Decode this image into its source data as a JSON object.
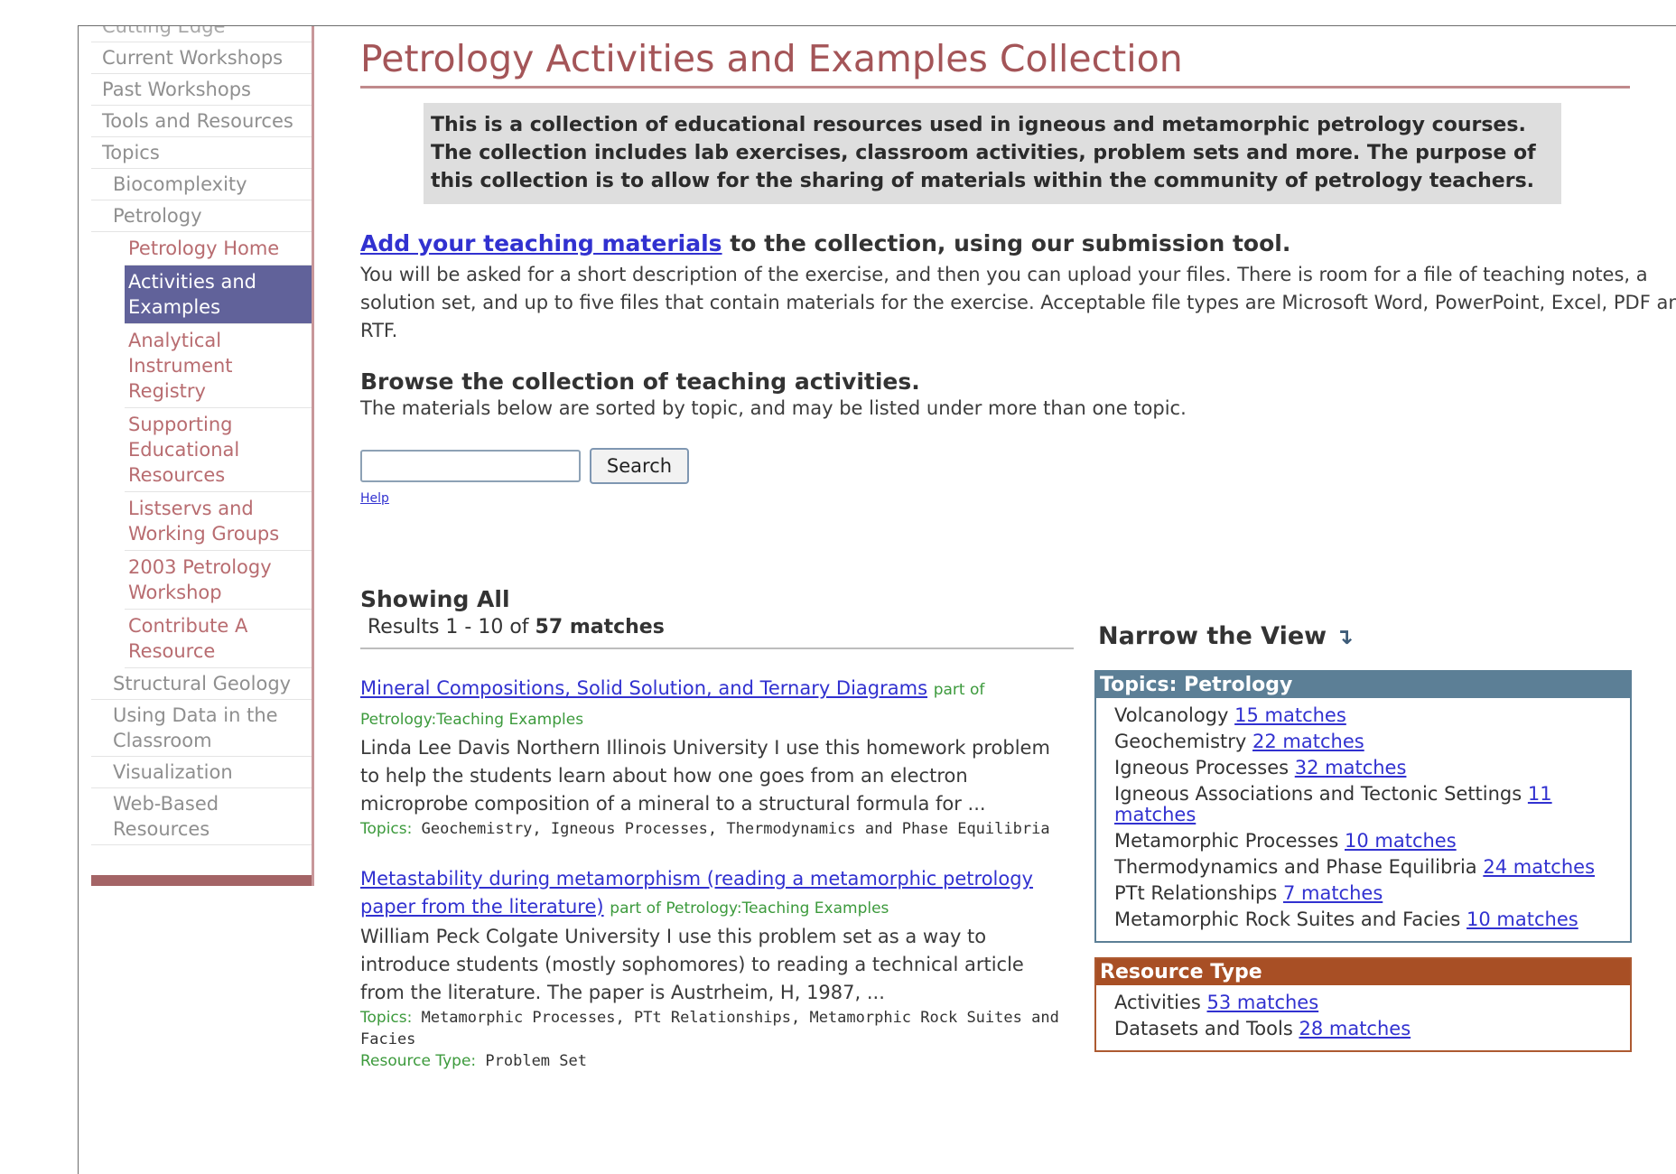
{
  "sidebar": {
    "cut_label": "Cutting Edge",
    "items": [
      {
        "label": "Current Workshops"
      },
      {
        "label": "Past Workshops"
      },
      {
        "label": "Tools and Resources"
      },
      {
        "label": "Topics"
      }
    ],
    "topics": [
      {
        "label": "Biocomplexity"
      },
      {
        "label": "Petrology"
      }
    ],
    "petrology_items": [
      {
        "label": "Petrology Home"
      },
      {
        "label": "Activities and Examples"
      },
      {
        "label": "Analytical Instrument Registry"
      },
      {
        "label": "Supporting Educational Resources"
      },
      {
        "label": "Listservs and Working Groups"
      },
      {
        "label": "2003 Petrology Workshop"
      },
      {
        "label": "Contribute A Resource"
      }
    ],
    "more_topics": [
      {
        "label": "Structural Geology"
      },
      {
        "label": "Using Data in the Classroom"
      },
      {
        "label": "Visualization"
      },
      {
        "label": "Web-Based Resources"
      }
    ]
  },
  "page": {
    "title": "Petrology Activities and Examples Collection",
    "intro": "This is a collection of educational resources used in igneous and metamorphic petrology courses. The collection includes lab exercises, classroom activities, problem sets and more. The purpose of this collection is to allow for the sharing of materials within the community of petrology teachers.",
    "add_link": "Add your teaching materials",
    "add_rest": " to the collection, using our submission tool.",
    "add_body": "You will be asked for a short description of the exercise, and then you can upload your files. There is room for a file of teaching notes, a solution set, and up to five files that contain materials for the exercise. Acceptable file types are Microsoft Word, PowerPoint, Excel, PDF and RTF.",
    "browse_head": "Browse the collection of teaching activities.",
    "browse_body": "The materials below are sorted by topic, and may be listed under more than one topic."
  },
  "search": {
    "value": "",
    "button": "Search",
    "help": "Help"
  },
  "results": {
    "showing": "Showing All",
    "summary_prefix": "Results 1 - 10 of ",
    "summary_count": "57 matches",
    "items": [
      {
        "title": "Mineral Compositions, Solid Solution, and Ternary Diagrams",
        "part_of": "part of Petrology:Teaching Examples",
        "desc": "Linda Lee Davis Northern Illinois University I use this homework problem to help the students learn about how one goes from an electron microprobe composition of a mineral to a structural formula for ...",
        "topics_label": "Topics:",
        "topics": "Geochemistry, Igneous Processes, Thermodynamics and Phase Equilibria"
      },
      {
        "title": "Metastability during metamorphism (reading a metamorphic petrology paper from the literature)",
        "part_of": "part of Petrology:Teaching Examples",
        "desc": "William Peck Colgate University I use this problem set as a way to introduce students (mostly sophomores) to reading a technical article from the literature. The paper is Austrheim, H, 1987, ...",
        "topics_label": "Topics:",
        "topics": "Metamorphic Processes, PTt Relationships, Metamorphic Rock Suites and Facies",
        "rtype_label": "Resource Type:",
        "rtype": "Problem Set"
      }
    ]
  },
  "narrow": {
    "title": "Narrow the View",
    "arrow": "↴",
    "topics_head": "Topics: Petrology",
    "topics": [
      {
        "name": "Volcanology",
        "matches": "15 matches"
      },
      {
        "name": "Geochemistry",
        "matches": "22 matches"
      },
      {
        "name": "Igneous Processes",
        "matches": "32 matches"
      },
      {
        "name": "Igneous Associations and Tectonic Settings",
        "matches": "11 matches"
      },
      {
        "name": "Metamorphic Processes",
        "matches": "10 matches"
      },
      {
        "name": "Thermodynamics and Phase Equilibria",
        "matches": "24 matches"
      },
      {
        "name": "PTt Relationships",
        "matches": "7 matches"
      },
      {
        "name": "Metamorphic Rock Suites and Facies",
        "matches": "10 matches"
      }
    ],
    "resource_head": "Resource Type",
    "resources": [
      {
        "name": "Activities",
        "matches": "53 matches"
      },
      {
        "name": "Datasets and Tools",
        "matches": "28 matches"
      }
    ]
  },
  "colors": {
    "title": "#a45558",
    "active_nav": "#61629a",
    "link": "#3131d0",
    "green_label": "#3c9a3c",
    "topics_facet": "#5c7f96",
    "resource_facet": "#a84f25"
  }
}
